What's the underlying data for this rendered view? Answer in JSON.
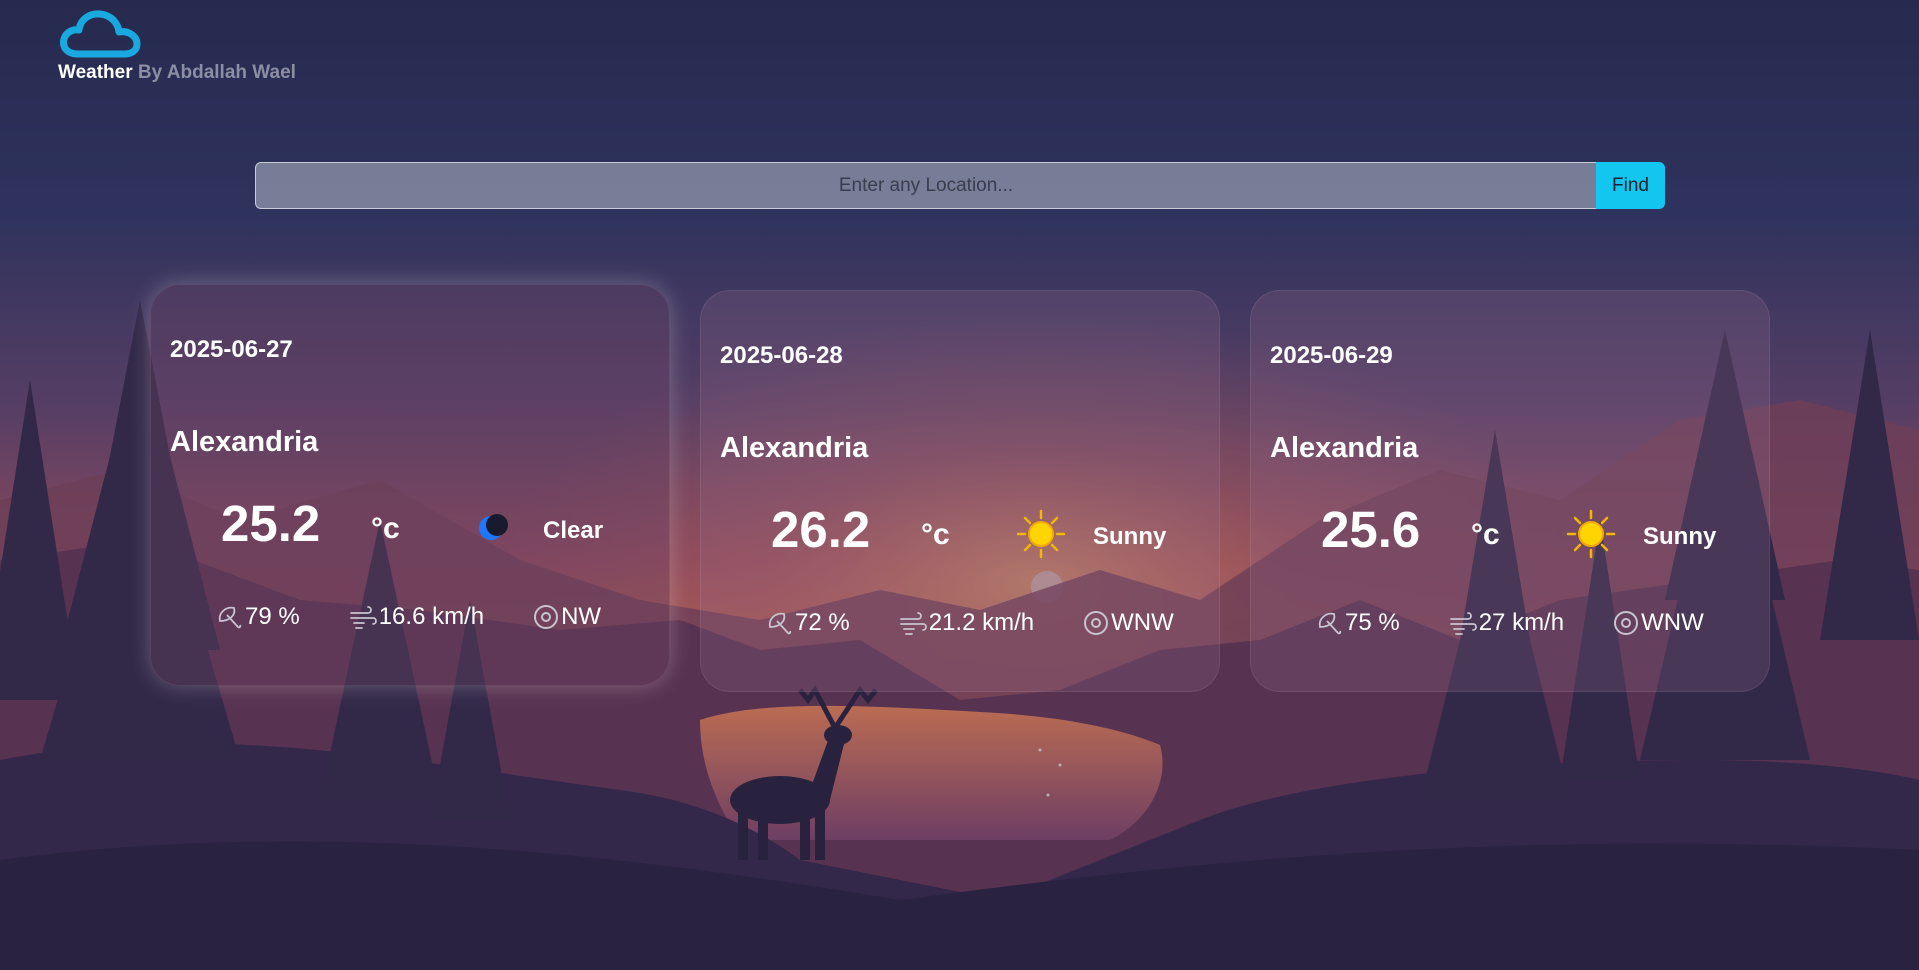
{
  "brand": {
    "name": "Weather",
    "by": "By Abdallah Wael"
  },
  "search": {
    "placeholder": "Enter any Location...",
    "button_label": "Find"
  },
  "cards": [
    {
      "date": "2025-06-27",
      "city": "Alexandria",
      "temp": "25.2",
      "unit": "°c",
      "condition": "Clear",
      "icon": "moon-icon",
      "humidity": "79 %",
      "wind": "16.6 km/h",
      "direction": "NW",
      "active": true
    },
    {
      "date": "2025-06-28",
      "city": "Alexandria",
      "temp": "26.2",
      "unit": "°c",
      "condition": "Sunny",
      "icon": "sun-icon",
      "humidity": "72 %",
      "wind": "21.2 km/h",
      "direction": "WNW",
      "active": false
    },
    {
      "date": "2025-06-29",
      "city": "Alexandria",
      "temp": "25.6",
      "unit": "°c",
      "condition": "Sunny",
      "icon": "sun-icon",
      "humidity": "75 %",
      "wind": "27 km/h",
      "direction": "WNW",
      "active": false
    }
  ],
  "colors": {
    "accent": "#12c6f0",
    "logo": "#1aa8e0",
    "muted": "#8c8ea4"
  }
}
